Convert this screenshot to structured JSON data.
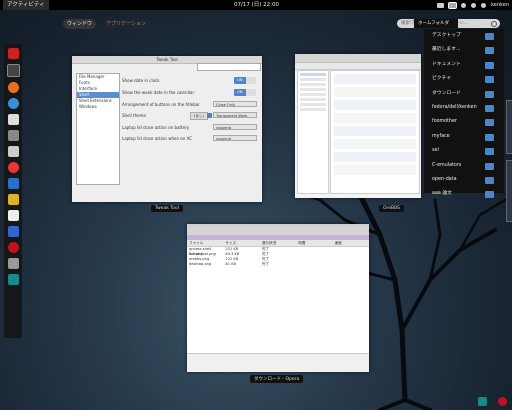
{
  "topbar": {
    "activities": "アクティビティ",
    "clock": "07/17 (日) 22:00",
    "user": "kenken"
  },
  "view_tabs": {
    "windows": "ウィンドウ",
    "apps": "アプリケーション"
  },
  "search": {
    "placeholder": "検索ワードを入力してください..."
  },
  "tooltip": {
    "text": "ホームフォルダ"
  },
  "places_menu": [
    {
      "label": "デスクトップ"
    },
    {
      "label": "最近します..."
    },
    {
      "label": "ドキュメント"
    },
    {
      "label": "ピクチャ"
    },
    {
      "label": "ダウンロード"
    },
    {
      "label": "fedora/dell/kenken"
    },
    {
      "label": "foomother"
    },
    {
      "label": "myface"
    },
    {
      "label": "sel"
    },
    {
      "label": "C-emulators"
    },
    {
      "label": "open-data"
    },
    {
      "label": "aaa 論文"
    }
  ],
  "tweak_tool": {
    "caption": "Tweak Tool",
    "window_title": "Tweak Tool",
    "categories": [
      "File Manager",
      "Fonts",
      "Interface",
      "Shell",
      "Shell Extensions",
      "Windows"
    ],
    "selected_category": "Shell",
    "settings": [
      {
        "label": "Show date in clock",
        "value": "ON"
      },
      {
        "label": "Show the week date in the calendar",
        "value": "ON"
      },
      {
        "label": "Arrangement of buttons on the titlebar",
        "value": "Close Only"
      },
      {
        "label": "Shell theme",
        "value": "Transparent Work"
      },
      {
        "label": "Laptop lid close action on battery",
        "value": "suspend"
      },
      {
        "label": "Laptop lid close action when on AC",
        "value": "suspend"
      }
    ],
    "shell_theme_button": "(なし)"
  },
  "orebbs": {
    "caption": "OreBBS"
  },
  "opera": {
    "caption": "ダウンロード - Opera",
    "columns": [
      "ファイル",
      "サイズ",
      "進行状況",
      "時間",
      "速度"
    ],
    "rows": [
      [
        "gnome-shell-3.1.png",
        "251 KB",
        "完了",
        "",
        ""
      ],
      [
        "tweak-tool.png",
        "64.3 KB",
        "完了",
        "",
        ""
      ],
      [
        "orebbs.png",
        "122 KB",
        "完了",
        "",
        ""
      ],
      [
        "desktop.png",
        "81 KB",
        "完了",
        "",
        ""
      ]
    ]
  },
  "colors": {
    "accent": "#4a86cf",
    "panel": "#000000"
  }
}
